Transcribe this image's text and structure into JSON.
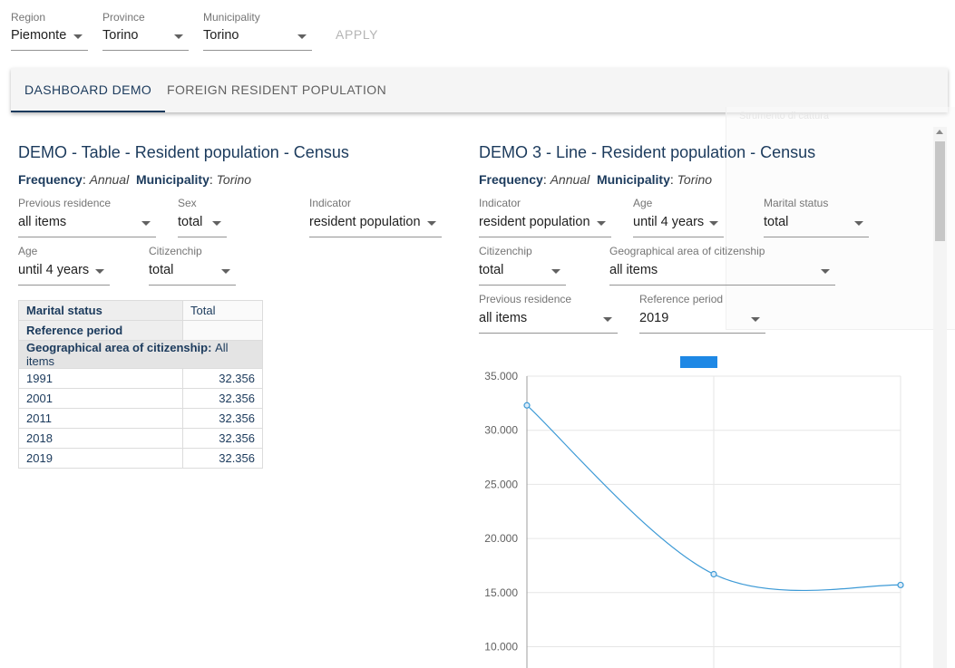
{
  "filters": {
    "region": {
      "label": "Region",
      "value": "Piemonte"
    },
    "province": {
      "label": "Province",
      "value": "Torino"
    },
    "municipality": {
      "label": "Municipality",
      "value": "Torino"
    },
    "apply_label": "APPLY"
  },
  "tabs": [
    {
      "label": "DASHBOARD DEMO",
      "active": true
    },
    {
      "label": "FOREIGN RESIDENT POPULATION",
      "active": false
    }
  ],
  "ghost_text": "Strumento di cattura",
  "table_panel": {
    "title": "DEMO - Table - Resident population - Census",
    "meta": {
      "frequency_key": "Frequency",
      "frequency_value": "Annual",
      "municipality_key": "Municipality",
      "municipality_value": "Torino"
    },
    "filters": [
      {
        "label": "Previous residence",
        "value": "all items"
      },
      {
        "label": "Sex",
        "value": "total"
      },
      {
        "label": "Indicator",
        "value": "resident population"
      },
      {
        "label": "Age",
        "value": "until 4 years"
      },
      {
        "label": "Citizenchip",
        "value": "total"
      }
    ],
    "table": {
      "marital_label": "Marital status",
      "marital_value": "Total",
      "period_label": "Reference period",
      "geo_label": "Geographical area of citizenship:",
      "geo_value": "All items",
      "rows": [
        {
          "year": "1991",
          "value": "32.356"
        },
        {
          "year": "2001",
          "value": "32.356"
        },
        {
          "year": "2011",
          "value": "32.356"
        },
        {
          "year": "2018",
          "value": "32.356"
        },
        {
          "year": "2019",
          "value": "32.356"
        }
      ]
    }
  },
  "line_panel": {
    "title": "DEMO 3 - Line - Resident population - Census",
    "meta": {
      "frequency_key": "Frequency",
      "frequency_value": "Annual",
      "municipality_key": "Municipality",
      "municipality_value": "Torino"
    },
    "filters": [
      {
        "label": "Indicator",
        "value": "resident population"
      },
      {
        "label": "Age",
        "value": "until 4 years"
      },
      {
        "label": "Marital status",
        "value": "total"
      },
      {
        "label": "Citizenchip",
        "value": "total"
      },
      {
        "label": "Geographical area of citizenship",
        "value": "all items"
      },
      {
        "label": "Previous residence",
        "value": "all items"
      },
      {
        "label": "Reference period",
        "value": "2019"
      }
    ]
  },
  "chart_data": {
    "type": "line",
    "title": "",
    "xlabel": "",
    "ylabel": "",
    "ylim": [
      10000,
      35000
    ],
    "y_tick_labels": [
      "35.000",
      "30.000",
      "25.000",
      "20.000",
      "15.000",
      "10.000"
    ],
    "y_ticks": [
      35000,
      30000,
      25000,
      20000,
      15000,
      10000
    ],
    "grid": true,
    "legend": "top",
    "series": [
      {
        "color": "#1e88e5",
        "values": [
          32300,
          16700,
          15700
        ]
      }
    ],
    "colors": {
      "line": "#3d9ad6",
      "legend": "#1e88e5",
      "grid": "#e6e6e6",
      "axis": "#9e9e9e"
    }
  }
}
